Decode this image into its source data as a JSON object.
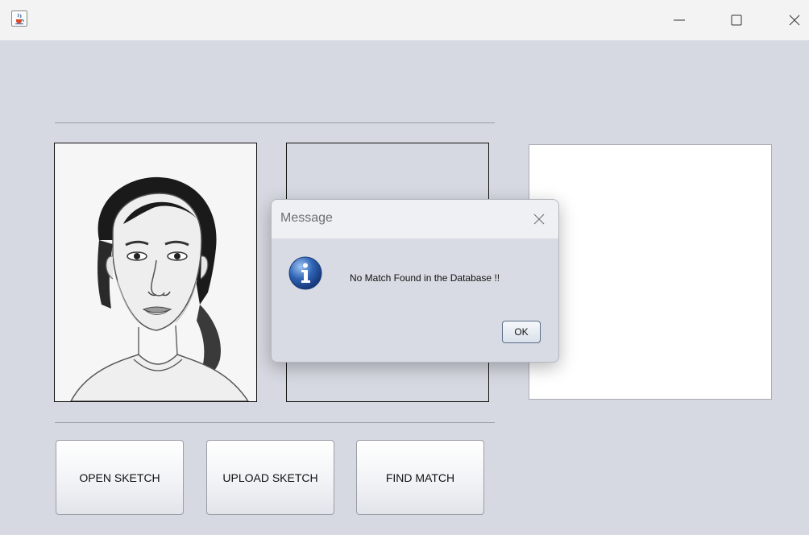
{
  "window": {
    "app_icon": "java-cup-icon",
    "controls": [
      "minimize-icon",
      "maximize-icon",
      "close-icon"
    ]
  },
  "buttons": {
    "open_sketch": "OPEN SKETCH",
    "upload_sketch": "UPLOAD SKETCH",
    "find_match": "FIND MATCH"
  },
  "dialog": {
    "title": "Message",
    "message": "No Match Found in the Database !!",
    "ok_label": "OK",
    "icon": "info-icon"
  },
  "colors": {
    "background": "#d6d9e1",
    "info_blue": "#2f63b3"
  }
}
